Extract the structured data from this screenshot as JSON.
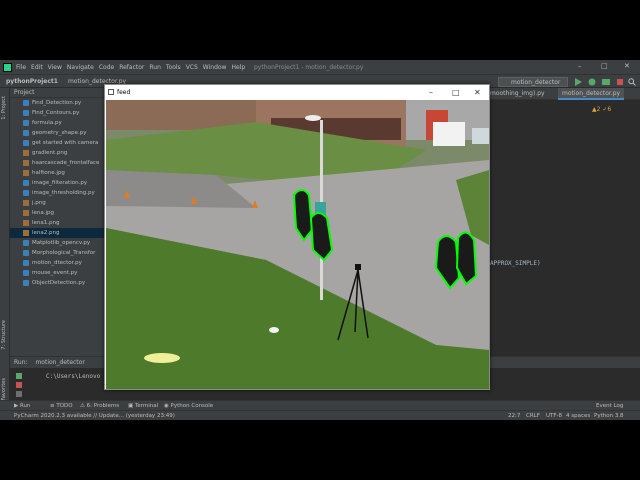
{
  "window": {
    "title": "pythonProject1 - motion_detector.py",
    "menu": [
      "File",
      "Edit",
      "View",
      "Navigate",
      "Code",
      "Refactor",
      "Run",
      "Tools",
      "VCS",
      "Window",
      "Help"
    ],
    "controls": [
      "–",
      "□",
      "✕"
    ]
  },
  "navbar": {
    "project": "pythonProject1",
    "file": "motion_detector.py",
    "run_config": "motion_detector"
  },
  "project_panel": {
    "header": "Project",
    "files": [
      {
        "name": "Find_Detection.py",
        "kind": "py"
      },
      {
        "name": "Find_Contours.py",
        "kind": "py"
      },
      {
        "name": "formula.py",
        "kind": "py"
      },
      {
        "name": "geometry_shape.py",
        "kind": "py"
      },
      {
        "name": "get started with camera",
        "kind": "py"
      },
      {
        "name": "gradient.png",
        "kind": "img"
      },
      {
        "name": "haarcascade_frontalface",
        "kind": "img"
      },
      {
        "name": "halftone.jpg",
        "kind": "img"
      },
      {
        "name": "image_filteration.py",
        "kind": "py"
      },
      {
        "name": "image_thresholding.py",
        "kind": "py"
      },
      {
        "name": "j.png",
        "kind": "img"
      },
      {
        "name": "lena.jpg",
        "kind": "img"
      },
      {
        "name": "lena1.png",
        "kind": "img"
      },
      {
        "name": "lena2.png",
        "kind": "img"
      },
      {
        "name": "Matplotlib_opencv.py",
        "kind": "py"
      },
      {
        "name": "Morphological_Transfor",
        "kind": "py"
      },
      {
        "name": "motion_dtector.py",
        "kind": "py"
      },
      {
        "name": "mouse_event.py",
        "kind": "py"
      },
      {
        "name": "ObjectDetection.py",
        "kind": "py"
      }
    ],
    "selected_index": 13
  },
  "editor": {
    "tabs": [
      "moothing_img).py",
      "motion_detector.py"
    ],
    "code_fragment": "APPROX_SIMPLE)",
    "warnings": "▲2  ✓6"
  },
  "run_panel": {
    "label": "Run:",
    "config": "motion_detector",
    "output": "C:\\Users\\Lenovo"
  },
  "bottom_tools": [
    "▶ Run",
    "≡ TODO",
    "⚠ 6: Problems",
    "▣ Terminal",
    "◉ Python Console",
    "Event Log"
  ],
  "status": {
    "message": "PyCharm 2020.2.3 available // Update... (yesterday 23:49)",
    "position": "22:7",
    "line_sep": "CRLF",
    "encoding": "UTF-8",
    "indent": "4 spaces",
    "interpreter": "Python 3.8"
  },
  "feed_window": {
    "title": "feed",
    "controls": [
      "–",
      "□",
      "✕"
    ]
  },
  "colors": {
    "ide_bg": "#2b2b2b",
    "panel_bg": "#3c3f41",
    "contour": "#00ff00",
    "grass": "#4e7a2c"
  }
}
